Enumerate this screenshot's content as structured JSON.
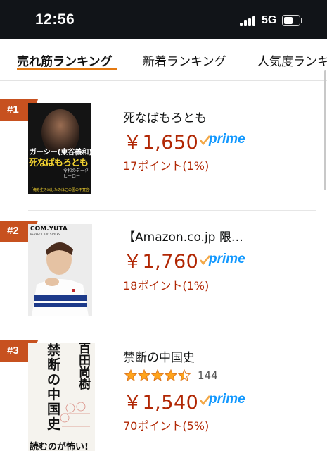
{
  "status_bar": {
    "time": "12:56",
    "network": "5G",
    "battery_level": 0.62
  },
  "tabs": [
    {
      "label": "売れ筋ランキング",
      "active": true
    },
    {
      "label": "新着ランキング",
      "active": false
    },
    {
      "label": "人気度ランキ",
      "active": false
    }
  ],
  "items": [
    {
      "rank": "#1",
      "title": "死なばもろとも",
      "cover_text": {
        "top": "ガーシー(東谷義和)",
        "main": "死なばもろとも",
        "side": "令和のダークヒーロー",
        "bottom": "「俺を生み出したのはこの国の不寛容や」"
      },
      "price": "￥1,650",
      "prime": "prime",
      "points": "17ポイント(1%)"
    },
    {
      "rank": "#2",
      "title": "【Amazon.co.jp 限…",
      "cover_text": {
        "top": "COM.YUTA",
        "sub": "PERFECT 100 STYLES"
      },
      "price": "￥1,760",
      "prime": "prime",
      "points": "18ポイント(1%)"
    },
    {
      "rank": "#3",
      "title": "禁断の中国史",
      "cover_text": {
        "author": "百田尚樹",
        "main": "禁断の中国史",
        "bottom": "読むのが怖い!"
      },
      "rating": 4.5,
      "review_count": "144",
      "price": "￥1,540",
      "prime": "prime",
      "points": "70ポイント(5%)"
    }
  ]
}
